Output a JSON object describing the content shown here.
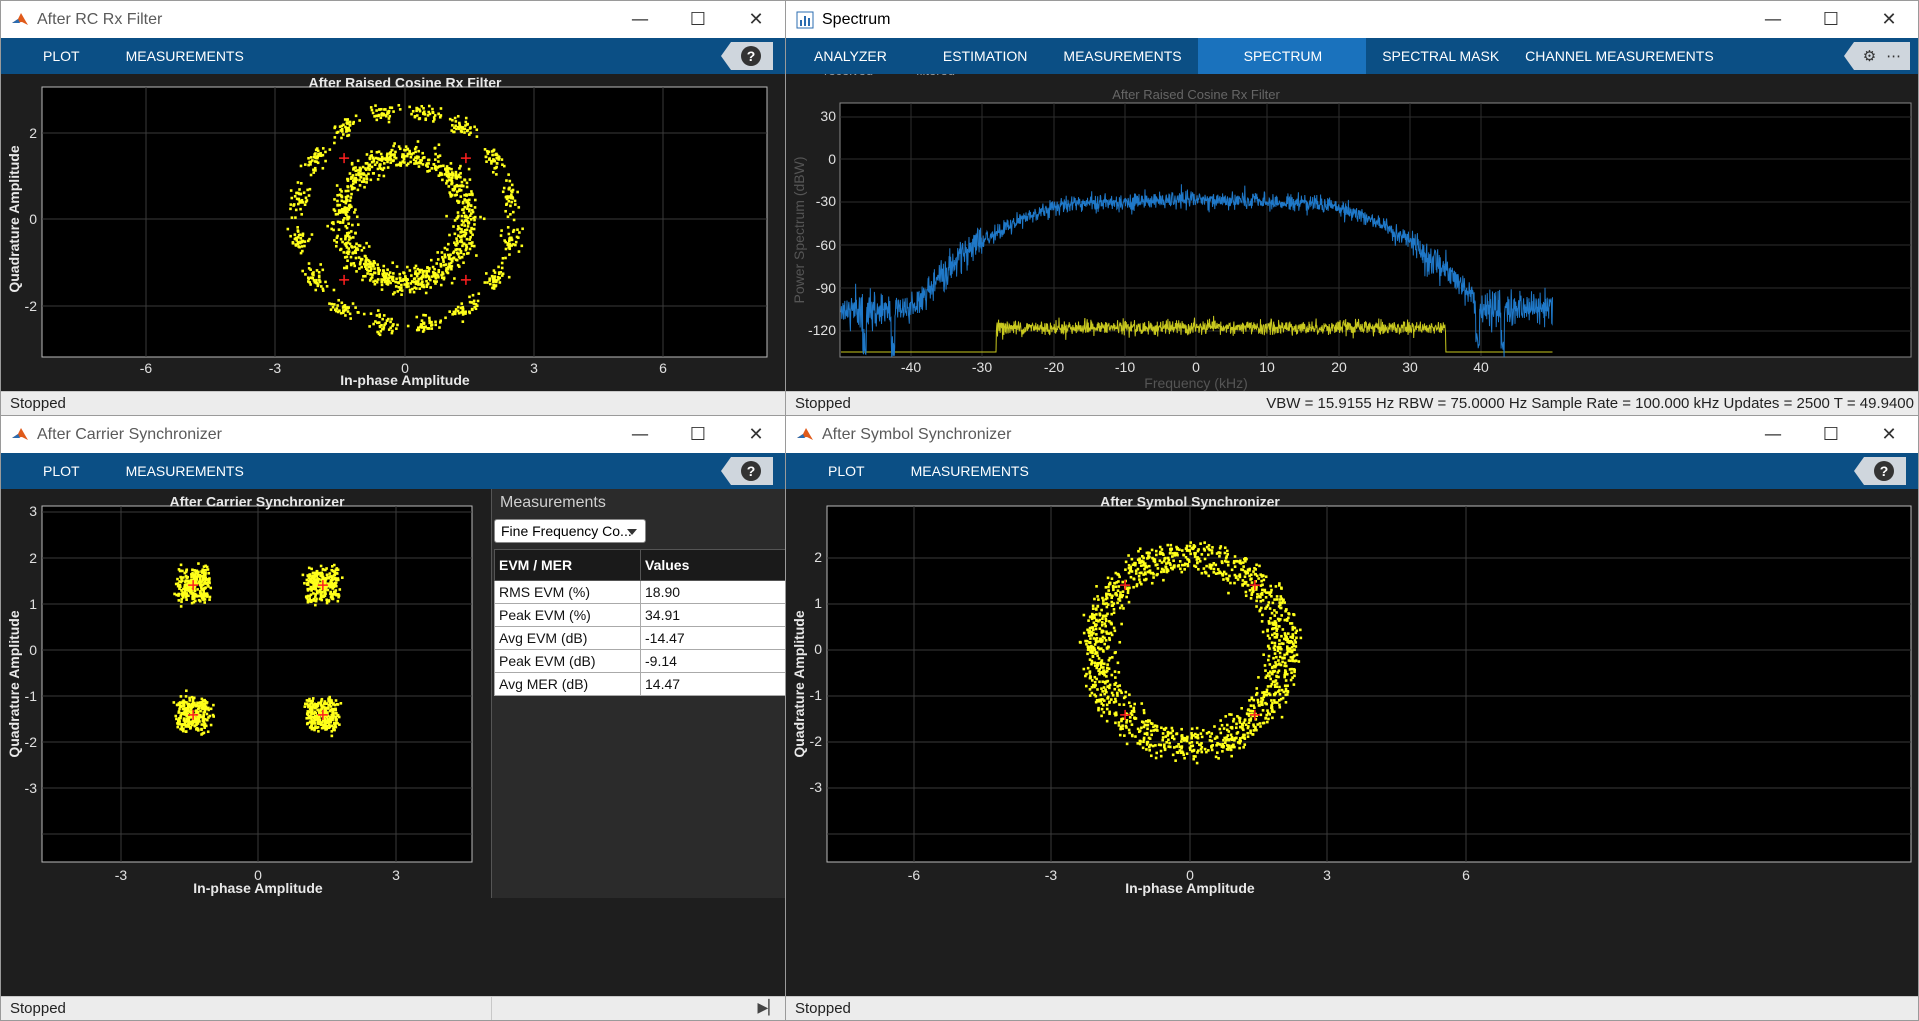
{
  "colors": {
    "accent_toolstrip": "#0b4f85",
    "selected_tab": "#1a72bd",
    "plot_bg": "#000000",
    "constellation": "#ffff1a",
    "reference": "#ff2020",
    "spectrum_filtered": "#1f78c8",
    "spectrum_received": "#c8c81e"
  },
  "win_rc": {
    "title": "After RC Rx Filter",
    "tabs": [
      "PLOT",
      "MEASUREMENTS"
    ],
    "plot_title": "After Raised Cosine Rx Filter",
    "xlabel": "In-phase Amplitude",
    "ylabel": "Quadrature Amplitude",
    "xticks": [
      "-6",
      "-3",
      "0",
      "3",
      "6"
    ],
    "yticks": [
      "2",
      "0",
      "-2"
    ],
    "status": "Stopped"
  },
  "win_spectrum": {
    "title": "Spectrum",
    "tabs": [
      "ANALYZER",
      "ESTIMATION",
      "MEASUREMENTS",
      "SPECTRUM",
      "SPECTRAL MASK",
      "CHANNEL MEASUREMENTS"
    ],
    "selected_tab": "SPECTRUM",
    "legend": [
      "received",
      "filtered"
    ],
    "plot_title": "After Raised Cosine Rx Filter",
    "xlabel": "Frequency (kHz)",
    "ylabel": "Power Spectrum (dBW)",
    "xticks": [
      "-40",
      "-30",
      "-20",
      "-10",
      "0",
      "10",
      "20",
      "30",
      "40"
    ],
    "yticks": [
      "30",
      "0",
      "-30",
      "-60",
      "-90",
      "-120"
    ],
    "status": "Stopped",
    "status_right": "VBW = 15.9155 Hz  RBW = 75.0000 Hz  Sample Rate = 100.000 kHz  Updates = 2500  T = 49.9400"
  },
  "win_carrier": {
    "title": "After Carrier Synchronizer",
    "tabs": [
      "PLOT",
      "MEASUREMENTS"
    ],
    "plot_title": "After Carrier Synchronizer",
    "xlabel": "In-phase Amplitude",
    "ylabel": "Quadrature Amplitude",
    "xticks": [
      "-3",
      "0",
      "3"
    ],
    "yticks": [
      "3",
      "2",
      "1",
      "0",
      "-1",
      "-2",
      "-3"
    ],
    "status": "Stopped",
    "measurements": {
      "header": "Measurements",
      "dropdown": "Fine Frequency Co...",
      "col1": "EVM / MER",
      "col2": "Values",
      "rows": [
        [
          "RMS EVM (%)",
          "18.90"
        ],
        [
          "Peak EVM (%)",
          "34.91"
        ],
        [
          "Avg EVM (dB)",
          "-14.47"
        ],
        [
          "Peak EVM (dB)",
          "-9.14"
        ],
        [
          "Avg MER (dB)",
          "14.47"
        ]
      ]
    }
  },
  "win_symbol": {
    "title": "After Symbol Synchronizer",
    "tabs": [
      "PLOT",
      "MEASUREMENTS"
    ],
    "plot_title": "After Symbol Synchronizer",
    "xlabel": "In-phase Amplitude",
    "ylabel": "Quadrature Amplitude",
    "xticks": [
      "-6",
      "-3",
      "0",
      "3",
      "6"
    ],
    "yticks": [
      "2",
      "1",
      "0",
      "-1",
      "-2",
      "-3"
    ],
    "status": "Stopped"
  }
}
